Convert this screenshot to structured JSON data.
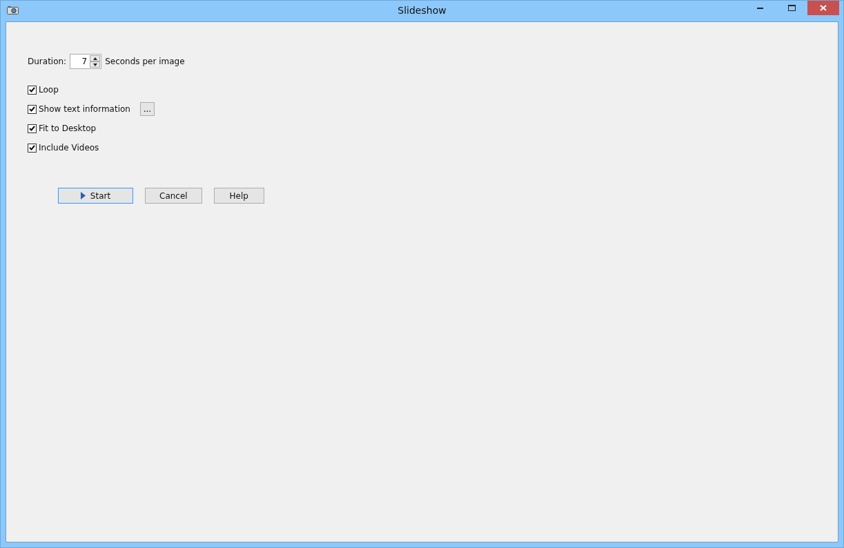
{
  "window": {
    "title": "Slideshow"
  },
  "duration": {
    "label": "Duration:",
    "value": "7",
    "unit": "Seconds per image"
  },
  "options": [
    {
      "label": "Loop",
      "checked": true
    },
    {
      "label": "Show text information",
      "checked": true,
      "button": "..."
    },
    {
      "label": "Fit to Desktop",
      "checked": true
    },
    {
      "label": "Include Videos",
      "checked": true
    }
  ],
  "buttons": [
    {
      "label": "Start",
      "default": true,
      "kind": "play"
    },
    {
      "label": "Cancel",
      "default": false,
      "kind": "plain"
    },
    {
      "label": "Help",
      "default": false,
      "kind": "plain"
    }
  ]
}
